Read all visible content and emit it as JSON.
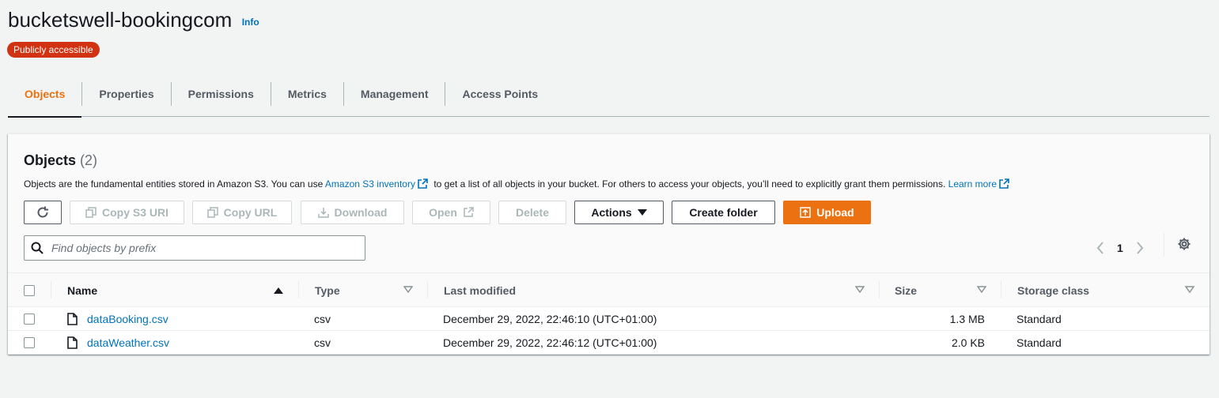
{
  "header": {
    "title": "bucketswell-bookingcom",
    "info_label": "Info",
    "badge": "Publicly accessible"
  },
  "tabs": [
    {
      "label": "Objects",
      "active": true
    },
    {
      "label": "Properties",
      "active": false
    },
    {
      "label": "Permissions",
      "active": false
    },
    {
      "label": "Metrics",
      "active": false
    },
    {
      "label": "Management",
      "active": false
    },
    {
      "label": "Access Points",
      "active": false
    }
  ],
  "panel": {
    "title": "Objects",
    "count": "(2)",
    "description": {
      "part1": "Objects are the fundamental entities stored in Amazon S3. You can use",
      "link1": "Amazon S3 inventory",
      "part2": "to get a list of all objects in your bucket. For others to access your objects, you’ll need to explicitly grant them permissions.",
      "link2": "Learn more"
    }
  },
  "toolbar": {
    "refresh_icon": "refresh-icon",
    "copy_s3_uri": "Copy S3 URI",
    "copy_url": "Copy URL",
    "download": "Download",
    "open": "Open",
    "delete": "Delete",
    "actions": "Actions",
    "create_folder": "Create folder",
    "upload": "Upload"
  },
  "search": {
    "placeholder": "Find objects by prefix",
    "value": ""
  },
  "pagination": {
    "current_page": "1"
  },
  "table": {
    "columns": {
      "name": "Name",
      "type": "Type",
      "last_modified": "Last modified",
      "size": "Size",
      "storage_class": "Storage class"
    },
    "rows": [
      {
        "name": "dataBooking.csv",
        "type": "csv",
        "last_modified": "December 29, 2022, 22:46:10 (UTC+01:00)",
        "size": "1.3 MB",
        "storage_class": "Standard"
      },
      {
        "name": "dataWeather.csv",
        "type": "csv",
        "last_modified": "December 29, 2022, 22:46:12 (UTC+01:00)",
        "size": "2.0 KB",
        "storage_class": "Standard"
      }
    ]
  },
  "colors": {
    "accent": "#ec7211",
    "link": "#0073bb",
    "badge": "#d13212",
    "background": "#f2f3f3"
  }
}
